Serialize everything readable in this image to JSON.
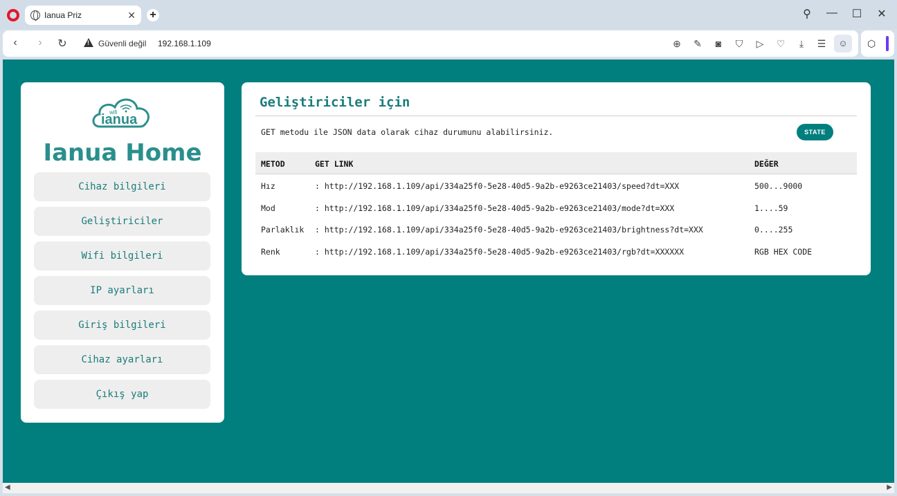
{
  "browser": {
    "tab_title": "Ianua Priz",
    "security_label": "Güvenli değil",
    "url": "192.168.1.109"
  },
  "sidebar": {
    "brand": "Ianua Home",
    "logo_text": "ianua",
    "logo_wifi": "wifi",
    "items": [
      {
        "label": "Cihaz bilgileri"
      },
      {
        "label": "Geliştiriciler"
      },
      {
        "label": "Wifi bilgileri"
      },
      {
        "label": "IP ayarları"
      },
      {
        "label": "Giriş bilgileri"
      },
      {
        "label": "Cihaz ayarları"
      },
      {
        "label": "Çıkış yap"
      }
    ]
  },
  "main": {
    "title": "Geliştiriciler için",
    "description": "GET metodu ile JSON data olarak cihaz durumunu alabilirsiniz.",
    "state_button": "STATE",
    "columns": [
      "METOD",
      "GET LINK",
      "DEĞER"
    ],
    "rows": [
      {
        "method": "Hız",
        "link": ": http://192.168.1.109/api/334a25f0-5e28-40d5-9a2b-e9263ce21403/speed?dt=XXX",
        "value": "500...9000"
      },
      {
        "method": "Mod",
        "link": ": http://192.168.1.109/api/334a25f0-5e28-40d5-9a2b-e9263ce21403/mode?dt=XXX",
        "value": "1....59"
      },
      {
        "method": "Parlaklık",
        "link": ": http://192.168.1.109/api/334a25f0-5e28-40d5-9a2b-e9263ce21403/brightness?dt=XXX",
        "value": "0....255"
      },
      {
        "method": "Renk",
        "link": ": http://192.168.1.109/api/334a25f0-5e28-40d5-9a2b-e9263ce21403/rgb?dt=XXXXXX",
        "value": "RGB HEX CODE"
      }
    ]
  },
  "colors": {
    "accent": "#017f7e",
    "brand_text": "#2a8f8c",
    "menu_bg": "#eeeeee"
  }
}
